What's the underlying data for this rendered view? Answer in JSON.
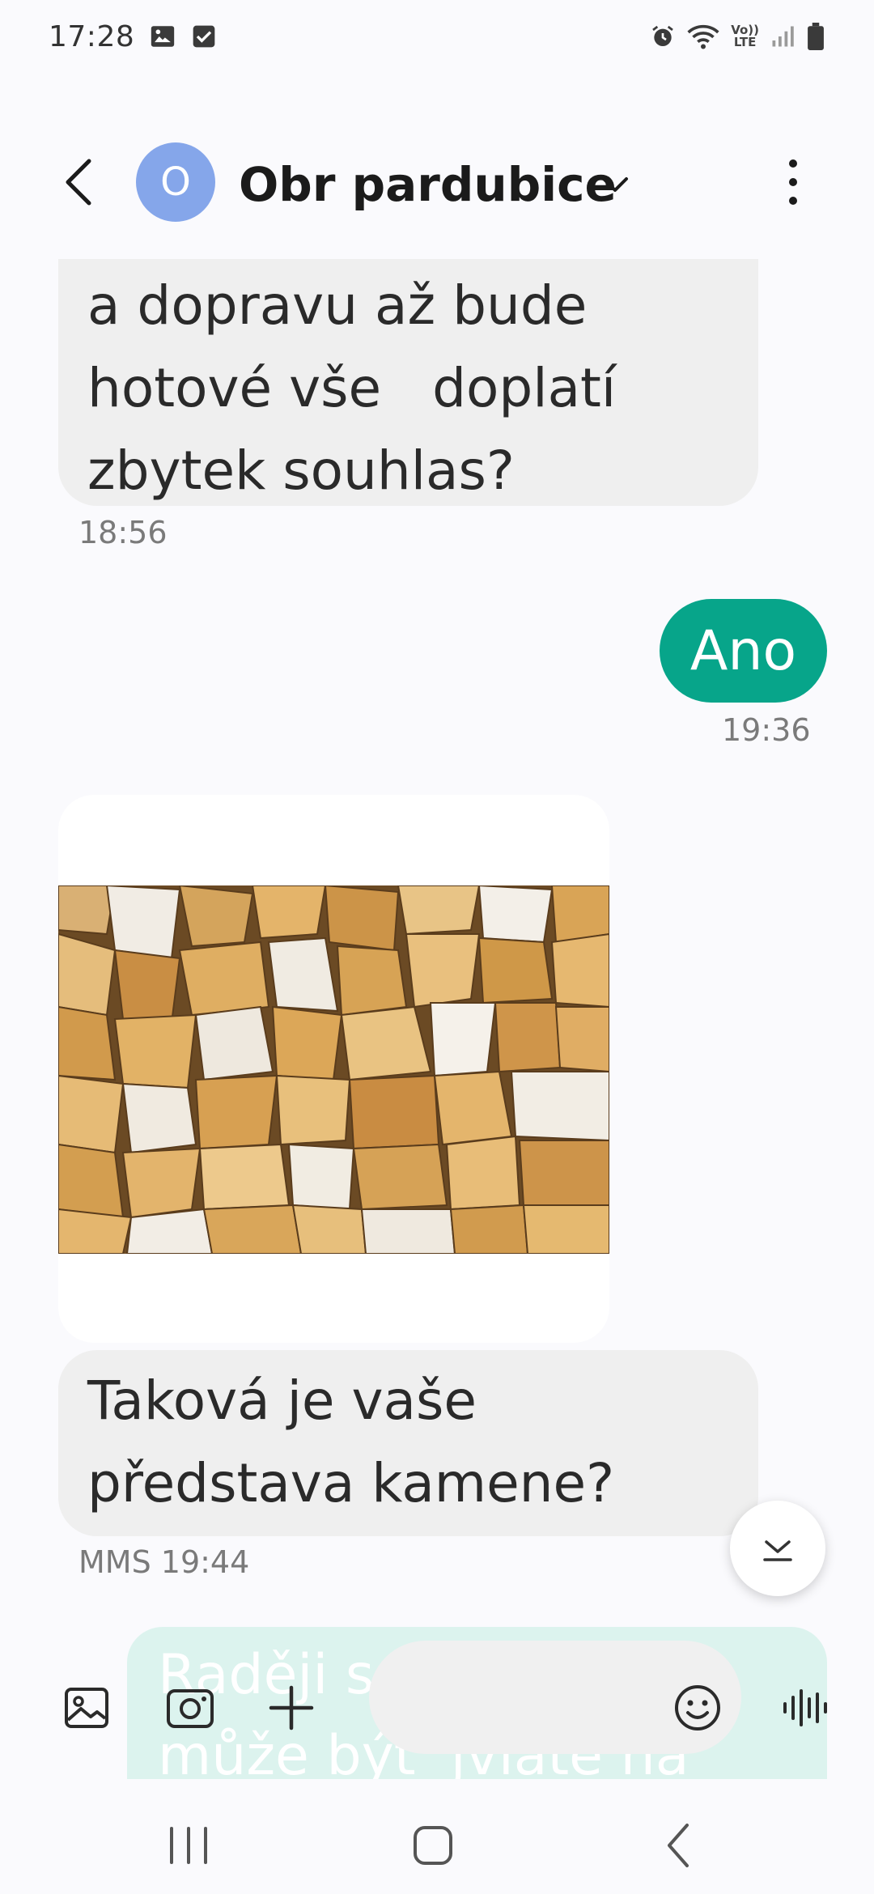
{
  "status_bar": {
    "time": "17:28",
    "notification_icons": [
      "gallery-icon",
      "checkbox-icon"
    ],
    "right_icons": [
      "alarm-icon",
      "wifi-icon",
      "volte-icon",
      "signal-icon",
      "battery-icon"
    ],
    "volte_top": "Vo))",
    "volte_bottom": "LTE"
  },
  "header": {
    "avatar_letter": "O",
    "contact_name": "Obr pardubice",
    "avatar_color": "#85a6ea"
  },
  "messages": {
    "incoming_1": {
      "lines": [
        "a dopravu až bude",
        "hotové vše   doplatí",
        "zbytek souhlas?"
      ],
      "time": "18:56"
    },
    "outgoing_1": {
      "text": "Ano",
      "time": "19:36"
    },
    "incoming_mms": {
      "image": "gravel-stones-photo",
      "lines": [
        "Taková je vaše",
        "představa kamene?"
      ],
      "time": "MMS 19:44"
    }
  },
  "compose": {
    "draft_lines": [
      "Raději s",
      "může být  jviate na"
    ],
    "accent_color": "#07a58a"
  },
  "colors": {
    "incoming_bubble": "#efefef",
    "outgoing_bubble": "#07a58a",
    "background": "#fafafd"
  }
}
